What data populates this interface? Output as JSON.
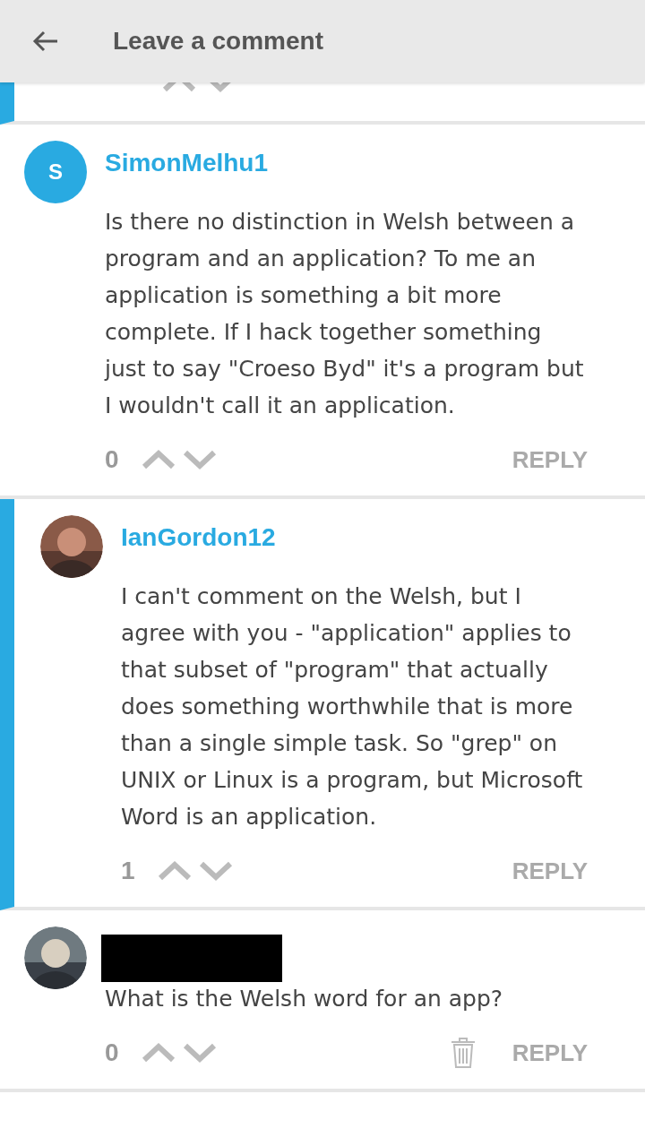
{
  "header": {
    "title": "Leave a comment"
  },
  "comments": [
    {
      "kind": "partial",
      "is_reply": true
    },
    {
      "kind": "full",
      "is_reply": false,
      "avatar": {
        "kind": "letter",
        "letter": "S"
      },
      "author_redacted": false,
      "author": "SimonMelhu1",
      "body": "Is there no distinction in Welsh between a program and an application? To me an application is something a bit more complete. If I hack together something just to say \"Croeso Byd\" it's a program but I wouldn't call it an application.",
      "votes": "0",
      "reply_label": "REPLY",
      "deletable": false
    },
    {
      "kind": "full",
      "is_reply": true,
      "author_redacted": false,
      "author": "IanGordon12",
      "body": "I can't comment on the Welsh, but I agree with you - \"application\" applies to that subset of \"program\" that actually does something worthwhile that is more than a single simple task. So \"grep\" on UNIX or Linux is a program, but Microsoft Word is an application.",
      "votes": "1",
      "reply_label": "REPLY",
      "deletable": false
    },
    {
      "kind": "full",
      "is_reply": false,
      "author_redacted": true,
      "body": "What is the Welsh word for an app?",
      "votes": "0",
      "reply_label": "REPLY",
      "deletable": true
    }
  ]
}
